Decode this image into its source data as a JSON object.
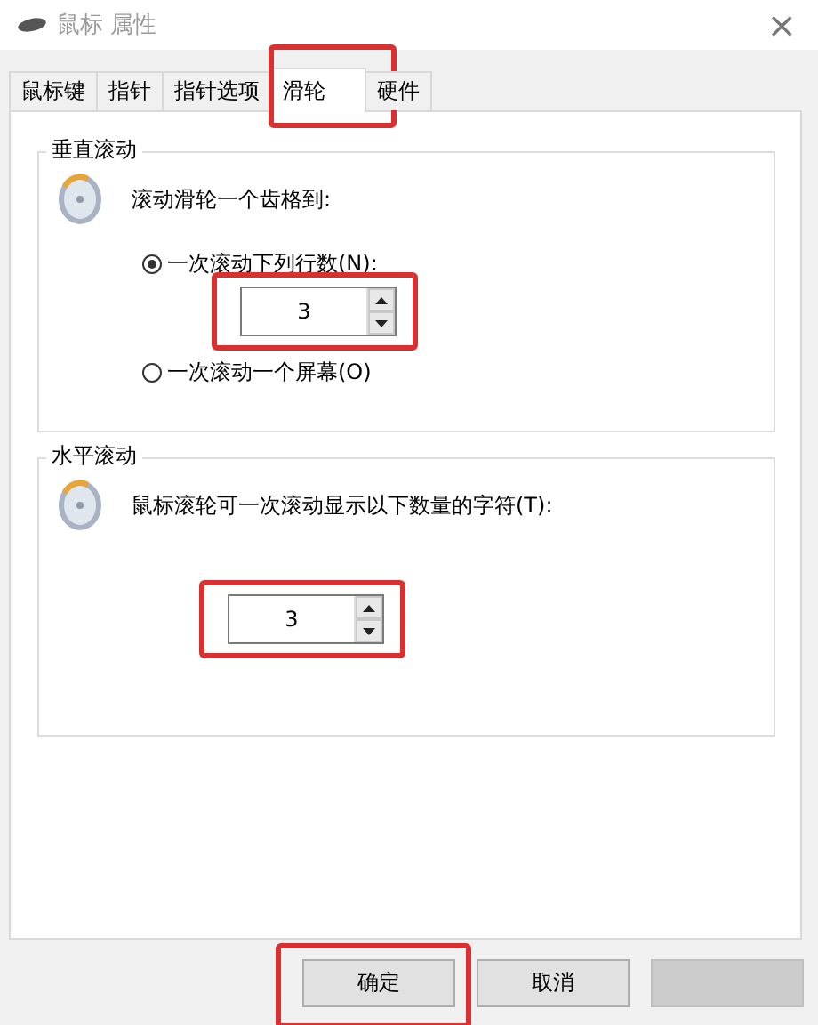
{
  "window": {
    "title": "鼠标 属性",
    "close": "×"
  },
  "tabs": [
    {
      "label": "鼠标键",
      "selected": false,
      "highlighted": false
    },
    {
      "label": "指针",
      "selected": false,
      "highlighted": false
    },
    {
      "label": "指针选项",
      "selected": false,
      "highlighted": false
    },
    {
      "label": "滑轮",
      "selected": true,
      "highlighted": true
    },
    {
      "label": "硬件",
      "selected": false,
      "highlighted": false
    }
  ],
  "vertical_scroll": {
    "title": "垂直滚动",
    "prompt": "滚动滑轮一个齿格到:",
    "options": [
      {
        "label": "一次滚动下列行数(N):",
        "selected": true,
        "spin": {
          "value": "3",
          "highlighted": true
        }
      },
      {
        "label": "一次滚动一个屏幕(O)",
        "selected": false
      }
    ]
  },
  "horizontal_scroll": {
    "title": "水平滚动",
    "prompt": "鼠标滚轮可一次滚动显示以下数量的字符(T):",
    "spin": {
      "value": "3",
      "highlighted": true
    }
  },
  "buttons": [
    {
      "label": "确定",
      "disabled": false,
      "highlighted": true
    },
    {
      "label": "取消",
      "disabled": false,
      "highlighted": false
    },
    {
      "disabled": true,
      "highlighted": false
    }
  ]
}
